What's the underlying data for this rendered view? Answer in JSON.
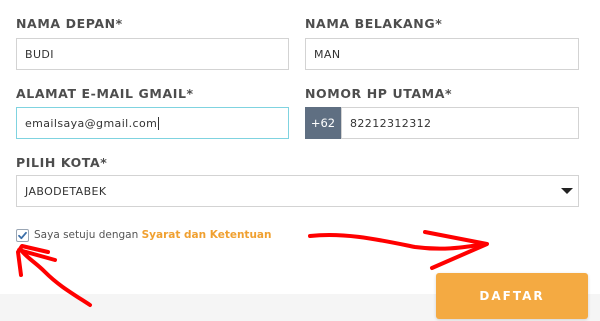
{
  "form": {
    "first_name": {
      "label": "NAMA DEPAN*",
      "value": "BUDI"
    },
    "last_name": {
      "label": "NAMA BELAKANG*",
      "value": "MAN"
    },
    "email": {
      "label": "ALAMAT E-MAIL GMAIL*",
      "value": "emailsaya@gmail.com"
    },
    "phone": {
      "label": "NOMOR HP UTAMA*",
      "prefix": "+62",
      "value": "82212312312"
    },
    "city": {
      "label": "PILIH KOTA*",
      "selected": "JABODETABEK"
    },
    "agreement": {
      "checked": true,
      "text": "Saya setuju dengan",
      "link": "Syarat dan Ketentuan"
    },
    "submit_label": "DAFTAR"
  },
  "colors": {
    "accent": "#f4aa42",
    "link": "#f0a030",
    "prefix_bg": "#5f6f82",
    "focus_border": "#7fd3e0",
    "annotation": "#ff0000"
  },
  "icons": {
    "checkbox": "check-icon",
    "select": "triangle-down-icon"
  }
}
